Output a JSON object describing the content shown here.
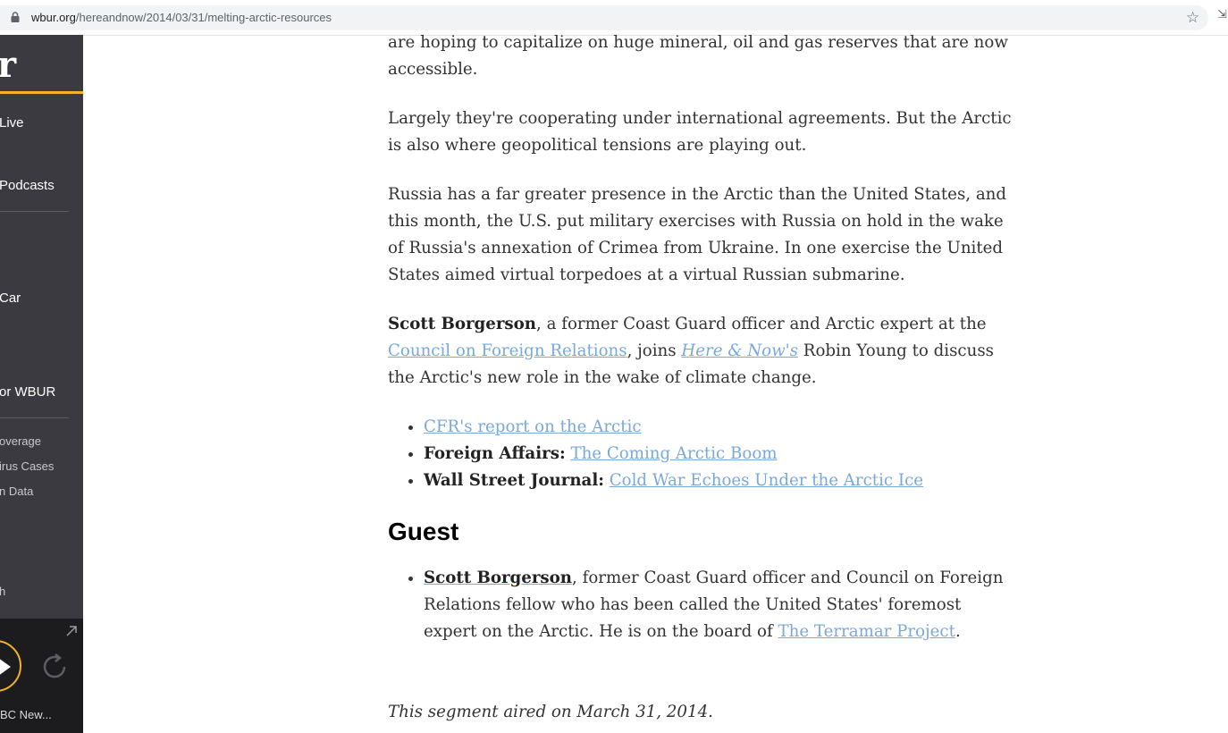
{
  "browser": {
    "url_domain": "wbur.org",
    "url_path": "/hereandnow/2014/03/31/melting-arctic-resources"
  },
  "sidebar": {
    "logo": "r",
    "nav": [
      "Live",
      "Podcasts",
      "Car",
      "or WBUR"
    ],
    "sub": [
      "overage",
      "irus Cases",
      "n Data",
      "h"
    ]
  },
  "player": {
    "now_playing": "BC New..."
  },
  "article": {
    "p1": "are hoping to capitalize on huge mineral, oil and gas reserves that are now accessible.",
    "p2": "Largely they're cooperating under international agreements. But the Arctic is also where geopolitical tensions are playing out.",
    "p3": "Russia has a far greater presence in the Arctic than the United States, and this month, the U.S. put military exercises with Russia on hold in the wake of Russia's annexation of Crimea from Ukraine. In one exercise the United States aimed virtual torpedoes at a virtual Russian submarine.",
    "p4": {
      "name": "Scott Borgerson",
      "t1": ", a former Coast Guard officer and Arctic expert at the ",
      "link1": "Council on Foreign Relations",
      "t2": ", joins ",
      "link2": "Here & Now",
      "t3": "'s",
      "t4": " Robin Young to discuss the Arctic's new role in the wake of climate change."
    },
    "links": {
      "l1": "CFR's report on the Arctic",
      "l2_label": "Foreign Affairs:",
      "l2_link": "The Coming Arctic Boom",
      "l3_label": "Wall Street Journal:",
      "l3_link": "Cold War Echoes Under the Arctic Ice"
    },
    "guest_heading": "Guest",
    "guest": {
      "name": "Scott Borgerson",
      "t1": ", former Coast Guard officer and Council on Foreign Relations fellow who has been called the United States' foremost expert on the Arctic. He is on the board of ",
      "link": "The Terramar Project",
      "t2": "."
    },
    "aired": "This segment aired on March 31, 2014."
  }
}
